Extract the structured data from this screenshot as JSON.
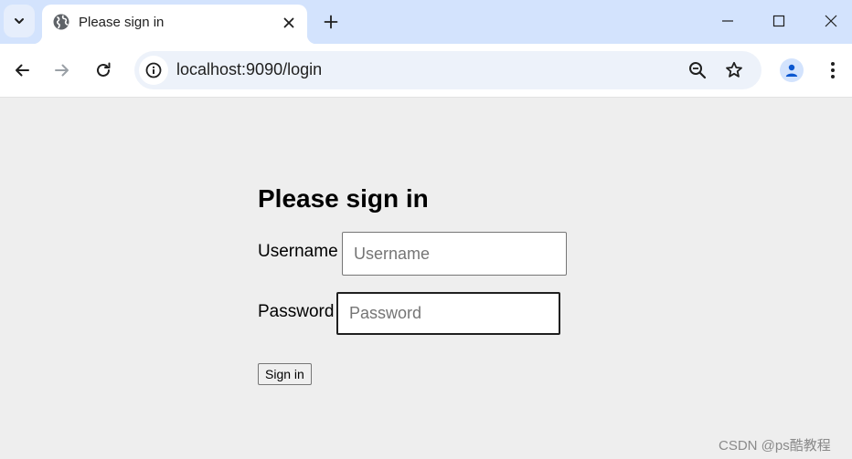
{
  "tab": {
    "title": "Please sign in"
  },
  "address_bar": {
    "url": "localhost:9090/login"
  },
  "form": {
    "heading": "Please sign in",
    "username_label": "Username",
    "username_placeholder": "Username",
    "username_value": "",
    "password_label": "Password",
    "password_placeholder": "Password",
    "password_value": "",
    "submit_label": "Sign in"
  },
  "watermark": "CSDN @ps酷教程",
  "icons": {
    "tab_search": "chevron-down-icon",
    "favicon": "globe-icon",
    "tab_close": "close-icon",
    "new_tab": "plus-icon",
    "minimize": "minimize-icon",
    "maximize": "maximize-icon",
    "close_window": "close-icon",
    "back": "arrow-left-icon",
    "forward": "arrow-right-icon",
    "reload": "reload-icon",
    "site_info": "info-icon",
    "zoom": "zoom-out-icon",
    "bookmark": "star-icon",
    "profile": "person-icon",
    "menu": "kebab-menu-icon"
  },
  "colors": {
    "tabstrip_bg": "#d3e3fd",
    "omnibox_bg": "#edf2fa",
    "page_bg": "#eeeeee"
  }
}
